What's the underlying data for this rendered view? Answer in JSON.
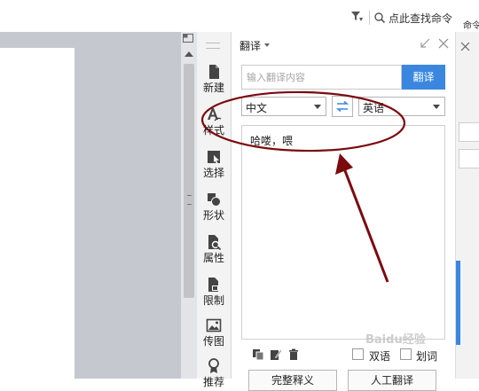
{
  "topbar": {
    "find_label": "点此查找命令",
    "cut_label": "命令"
  },
  "toolbar": {
    "items": [
      {
        "label": "新建",
        "icon": "new-doc-icon"
      },
      {
        "label": "样式",
        "icon": "style-icon"
      },
      {
        "label": "选择",
        "icon": "select-icon"
      },
      {
        "label": "形状",
        "icon": "shape-icon"
      },
      {
        "label": "属性",
        "icon": "property-icon"
      },
      {
        "label": "限制",
        "icon": "restrict-icon"
      },
      {
        "label": "传图",
        "icon": "upload-image-icon"
      },
      {
        "label": "推荐",
        "icon": "recommend-icon"
      }
    ]
  },
  "panel": {
    "title": "翻译",
    "input": {
      "placeholder": "输入翻译内容",
      "value": ""
    },
    "translate_button": "翻译",
    "source_lang": "中文",
    "target_lang": "英语",
    "result_text": "哈喽，喂",
    "checkbox_bilingual": "双语",
    "checkbox_word": "划词",
    "full_def_button": "完整释义",
    "human_translate_button": "人工翻译"
  },
  "watermark": "Baidu经验",
  "colors": {
    "accent": "#3b87e0",
    "annotation": "#7b0a0f",
    "doc_background": "#c6c8d0"
  }
}
